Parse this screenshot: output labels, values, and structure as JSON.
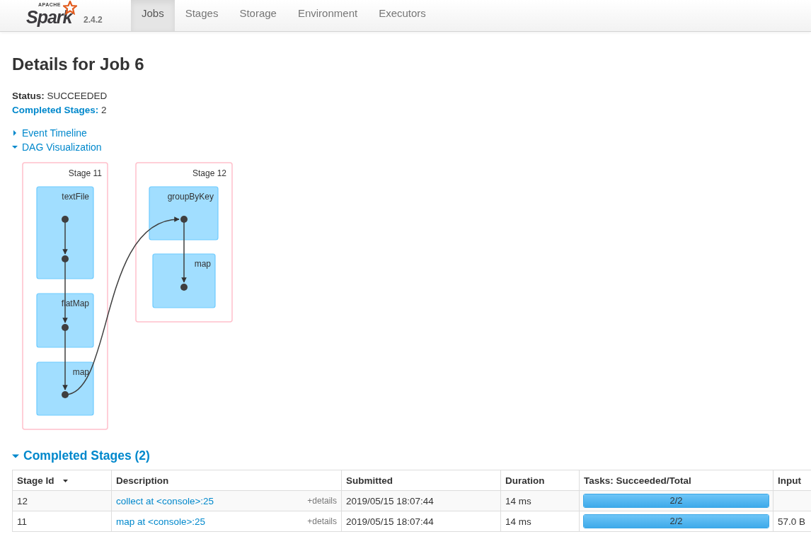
{
  "navbar": {
    "logo": {
      "apache": "APACHE",
      "brand": "Spark",
      "version": "2.4.2"
    },
    "tabs": [
      {
        "label": "Jobs",
        "selected": true
      },
      {
        "label": "Stages",
        "selected": false
      },
      {
        "label": "Storage",
        "selected": false
      },
      {
        "label": "Environment",
        "selected": false
      },
      {
        "label": "Executors",
        "selected": false
      }
    ]
  },
  "title": "Details for Job 6",
  "summary": [
    {
      "label": "Status:",
      "value": "SUCCEEDED",
      "kind": "plain"
    },
    {
      "label": "Completed Stages:",
      "value": "2",
      "kind": "link"
    }
  ],
  "toggles": [
    {
      "label": "Event Timeline",
      "expanded": false
    },
    {
      "label": "DAG Visualization",
      "expanded": true
    }
  ],
  "dag": {
    "stages": [
      {
        "label": "Stage 11",
        "operations": [
          "textFile",
          "flatMap",
          "map"
        ]
      },
      {
        "label": "Stage 12",
        "operations": [
          "groupByKey",
          "map"
        ]
      }
    ]
  },
  "completed_stages": {
    "heading": "Completed Stages (2)",
    "expanded": true,
    "columns": [
      "Stage Id",
      "Description",
      "Submitted",
      "Duration",
      "Tasks: Succeeded/Total",
      "Input"
    ],
    "rows": [
      {
        "stage_id": "12",
        "description": "collect at <console>:25",
        "details": "+details",
        "submitted": "2019/05/15 18:07:44",
        "duration": "14 ms",
        "tasks": "2/2",
        "level": 1,
        "input": ""
      },
      {
        "stage_id": "11",
        "description": "map at <console>:25",
        "details": "+details",
        "submitted": "2019/05/15 18:07:44",
        "duration": "14 ms",
        "tasks": "2/2",
        "level": 1,
        "input": "57.0 B"
      }
    ]
  }
}
